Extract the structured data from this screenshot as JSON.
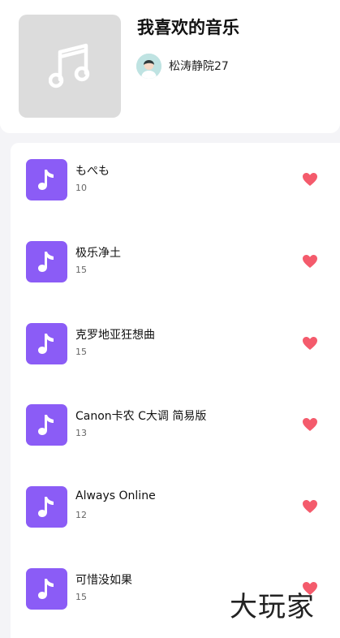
{
  "playlist": {
    "title": "我喜欢的音乐",
    "cover_icon": "music-note-icon",
    "creator": {
      "name": "松涛静院27",
      "avatar_icon": "user-avatar"
    }
  },
  "songs": [
    {
      "title": "もぺも",
      "count": "10"
    },
    {
      "title": "极乐净土",
      "count": "15"
    },
    {
      "title": "克罗地亚狂想曲",
      "count": "15"
    },
    {
      "title": "Canon卡农 C大调 简易版",
      "count": "13"
    },
    {
      "title": "Always Online",
      "count": "12"
    },
    {
      "title": "可惜没如果",
      "count": "15"
    }
  ],
  "watermark": "大玩家",
  "colors": {
    "accent": "#8b5cf6",
    "heart": "#f45b6c",
    "cover": "#dcdcdc"
  }
}
